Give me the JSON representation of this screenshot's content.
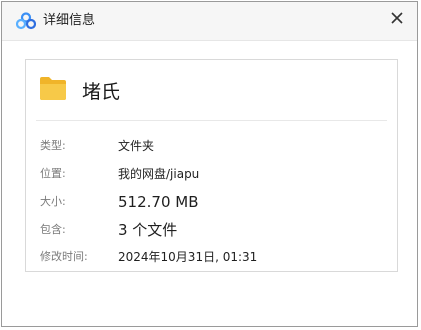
{
  "window": {
    "title": "详细信息",
    "icon": "cloud-logo-icon",
    "close_icon": "close-icon"
  },
  "file": {
    "name": "堵氏",
    "icon": "folder-icon",
    "folder_color": "#f4c542"
  },
  "details": {
    "type": {
      "label": "类型:",
      "value": "文件夹"
    },
    "location": {
      "label": "位置:",
      "value": "我的网盘/jiapu"
    },
    "size": {
      "label": "大小:",
      "value": "512.70 MB"
    },
    "contains": {
      "label": "包含:",
      "value": "3 个文件"
    },
    "modified": {
      "label": "修改时间:",
      "value": "2024年10月31日, 01:31"
    }
  }
}
